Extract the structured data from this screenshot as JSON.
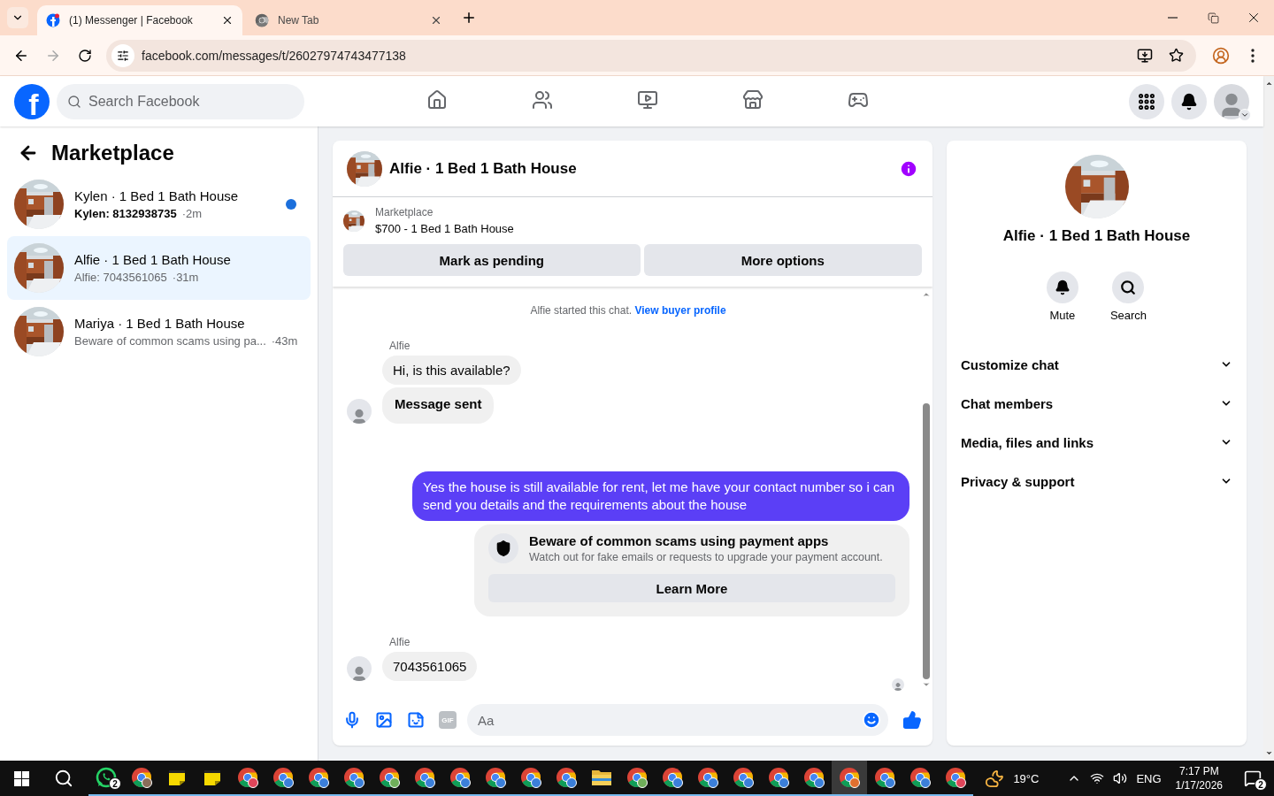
{
  "browser": {
    "tabs": [
      {
        "title": "(1) Messenger | Facebook",
        "kind": "facebook",
        "selected": true
      },
      {
        "title": "New Tab",
        "kind": "chrome",
        "selected": false
      }
    ],
    "url": "facebook.com/messages/t/26027974743477138"
  },
  "header": {
    "logo": "f",
    "search_placeholder": "Search Facebook",
    "nav": [
      {
        "kind": "home"
      },
      {
        "kind": "friends"
      },
      {
        "kind": "video"
      },
      {
        "kind": "marketplace"
      },
      {
        "kind": "gaming"
      }
    ]
  },
  "sidebar": {
    "title": "Marketplace",
    "chats": [
      {
        "name": "Kylen · 1 Bed 1 Bath House",
        "preview": "Kylen: 8132938735",
        "time": "·2m",
        "unread": true,
        "selected": false
      },
      {
        "name": "Alfie · 1 Bed 1 Bath House",
        "preview": "Alfie: 7043561065",
        "time": "·31m",
        "unread": false,
        "selected": true
      },
      {
        "name": "Mariya · 1 Bed 1 Bath House",
        "preview": "Beware of common scams using pa...",
        "time": "·43m",
        "unread": false,
        "selected": false
      }
    ]
  },
  "chat": {
    "title": "Alfie · 1 Bed 1 Bath House",
    "listing": {
      "source": "Marketplace",
      "title": "$700 - 1 Bed 1 Bath House"
    },
    "actions": [
      "Mark as pending",
      "More options"
    ],
    "messages": [
      {
        "kind": "system",
        "text": "Alfie started this chat.",
        "link": "View buyer profile"
      },
      {
        "kind": "incoming",
        "sender": "Alfie",
        "bubbles": [
          {
            "text": "Hi, is this available?",
            "bold": false
          },
          {
            "text": "Message sent",
            "bold": true
          }
        ]
      },
      {
        "kind": "outgoing",
        "text": "Yes the house is still available for rent, let me have your contact number so i can send you details and the requirements about the house"
      },
      {
        "kind": "warning",
        "title": "Beware of common scams using payment apps",
        "body": "Watch out for fake emails or requests to upgrade your payment account.",
        "button": "Learn More"
      },
      {
        "kind": "incoming",
        "sender": "Alfie",
        "bubbles": [
          {
            "text": "7043561065",
            "bold": false
          }
        ]
      }
    ],
    "composer": {
      "gif": "GIF",
      "placeholder": "Aa"
    }
  },
  "details": {
    "title": "Alfie · 1 Bed 1 Bath House",
    "actions": [
      {
        "kind": "mute",
        "label": "Mute"
      },
      {
        "kind": "search",
        "label": "Search"
      }
    ],
    "sections": [
      {
        "label": "Customize chat",
        "expanded": false
      },
      {
        "label": "Chat members",
        "expanded": false
      },
      {
        "label": "Media, files and links",
        "expanded": false
      },
      {
        "label": "Privacy & support",
        "expanded": false
      }
    ]
  },
  "taskbar": {
    "apps": [
      {
        "kind": "whatsapp",
        "badge": "2",
        "selected": false
      },
      {
        "kind": "chrome",
        "color": "#8a6d5a",
        "selected": false
      },
      {
        "kind": "sticky",
        "selected": false
      },
      {
        "kind": "sticky",
        "selected": false
      },
      {
        "kind": "chrome",
        "color": "#e0455a",
        "selected": false
      },
      {
        "kind": "chrome",
        "color": "#3b7fd9",
        "selected": false
      },
      {
        "kind": "chrome",
        "color": "#3b7fd9",
        "selected": false
      },
      {
        "kind": "chrome",
        "color": "#3b7fd9",
        "selected": false
      },
      {
        "kind": "chrome",
        "color": "#6fae5a",
        "selected": false
      },
      {
        "kind": "chrome",
        "color": "#3b7fd9",
        "selected": false
      },
      {
        "kind": "chrome",
        "color": "#3b7fd9",
        "selected": false
      },
      {
        "kind": "chrome",
        "color": "#3b7fd9",
        "selected": false
      },
      {
        "kind": "chrome",
        "color": "#3b7fd9",
        "selected": false
      },
      {
        "kind": "chrome",
        "color": "#3b7fd9",
        "selected": false
      },
      {
        "kind": "folder",
        "selected": false
      },
      {
        "kind": "chrome",
        "color": "#6fae5a",
        "selected": false
      },
      {
        "kind": "chrome",
        "color": "#3b7fd9",
        "selected": false
      },
      {
        "kind": "chrome",
        "color": "#3b7fd9",
        "selected": false
      },
      {
        "kind": "chrome",
        "color": "#3b7fd9",
        "selected": false
      },
      {
        "kind": "chrome",
        "color": "#3b7fd9",
        "selected": false
      },
      {
        "kind": "chrome",
        "color": "#3b7fd9",
        "selected": false
      },
      {
        "kind": "chrome",
        "color": "#e0702f",
        "selected": true
      },
      {
        "kind": "chrome",
        "color": "#3b7fd9",
        "selected": false
      },
      {
        "kind": "chrome",
        "color": "#3b7fd9",
        "selected": false
      },
      {
        "kind": "chrome",
        "color": "#e0455a",
        "selected": false
      }
    ],
    "weather": "19°C",
    "language": "ENG",
    "time": "7:17 PM",
    "date": "1/17/2026",
    "notifications": "2"
  }
}
